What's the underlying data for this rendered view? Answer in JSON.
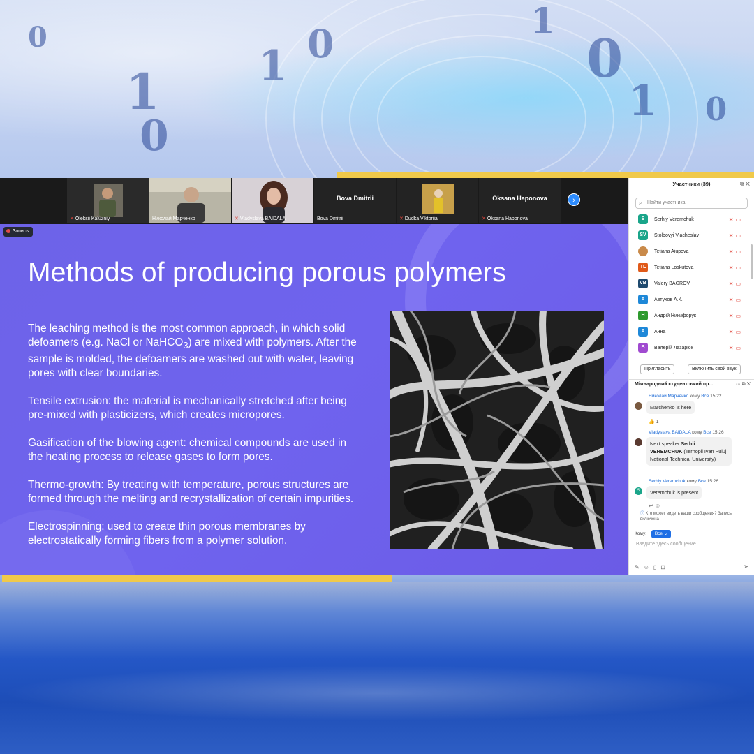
{
  "videos": {
    "tiles": [
      {
        "name": "Oleksii Kaluzniy",
        "muted": true
      },
      {
        "name": "Николай Марченко",
        "muted": false
      },
      {
        "name": "Vladyslava BAIDALA",
        "muted": true
      },
      {
        "name": "Bova Dmitrii",
        "muted": false,
        "placeholder_name": "Bova Dmitrii"
      },
      {
        "name": "Dudka Viktoriia",
        "muted": true
      },
      {
        "name": "Oksana Haponova",
        "muted": true,
        "placeholder_name": "Oksana Haponova"
      }
    ],
    "next_icon": "chevron-right-icon"
  },
  "recording": {
    "label": "Запись"
  },
  "slide": {
    "title": "Methods of producing porous polymers",
    "paragraphs": [
      {
        "pre": "The leaching method is the most common approach, in which solid defoamers (e.g. NaCl or NaHCO",
        "sub": "3",
        "post": ") are mixed with polymers. After the sample is molded, the defoamers are washed out with water, leaving pores with clear boundaries."
      },
      {
        "pre": "Tensile extrusion: the material is mechanically stretched after being pre-mixed with plasticizers, which creates micropores.",
        "sub": "",
        "post": ""
      },
      {
        "pre": "Gasification of the blowing agent: chemical compounds are used in the heating process to release gases to form pores.",
        "sub": "",
        "post": ""
      },
      {
        "pre": "Thermo-growth: By treating with temperature, porous structures are formed through the melting and recrystallization of certain impurities.",
        "sub": "",
        "post": ""
      },
      {
        "pre": "Electrospinning: used to create thin porous membranes by electrostatically forming fibers from a polymer solution.",
        "sub": "",
        "post": ""
      }
    ]
  },
  "participants": {
    "title": "Участники (39)",
    "search_placeholder": "Найти участника",
    "list": [
      {
        "initials": "S",
        "name": "Serhiy Veremchuk",
        "color": "#1aa58a"
      },
      {
        "initials": "SV",
        "name": "Stolbovyi Viacheslav",
        "color": "#1aa58a"
      },
      {
        "initials": "",
        "name": "Tetiana Aiupova",
        "color": "#c98a4a"
      },
      {
        "initials": "TL",
        "name": "Tetiana Loskutova",
        "color": "#e05a1a"
      },
      {
        "initials": "VB",
        "name": "Valery BAGROV",
        "color": "#1f4a6e"
      },
      {
        "initials": "A",
        "name": "Автухов А.К.",
        "color": "#1e88d8"
      },
      {
        "initials": "H",
        "name": "Андрій Никифорук",
        "color": "#2e9a2e"
      },
      {
        "initials": "A",
        "name": "Анна",
        "color": "#1e88d8"
      },
      {
        "initials": "B",
        "name": "Валерій Лазарюк",
        "color": "#a04ad0"
      }
    ],
    "invite_label": "Пригласить",
    "unmute_label": "Включить свой звук"
  },
  "chat": {
    "title": "Міжнародний студентський пр...",
    "messages": [
      {
        "sender": "Николай Марченко",
        "to_word": "кому",
        "to": "Все",
        "time": "15:22",
        "text": "Marchenko is here",
        "reaction": "👍 1"
      },
      {
        "sender": "Vladyslava BAIDALA",
        "to_word": "кому",
        "to": "Все",
        "time": "15:26",
        "text_pre": "Next speaker ",
        "text_bold": "Serhii VEREMCHUK",
        "text_post": " (Ternopil Ivan Puluj National Technical University)"
      },
      {
        "sender": "Serhiy Veremchuk",
        "to_word": "кому",
        "to": "Все",
        "time": "15:26",
        "text": "Veremchuk is present"
      }
    ],
    "visibility_note": "Кто может видеть ваши сообщения? Запись включена",
    "to_label": "Кому:",
    "to_value": "Все",
    "input_placeholder": "Введите здесь сообщение..."
  },
  "colors": {
    "slide_bg": "#6f63ee",
    "accent_gold": "#f0c94a",
    "zoom_blue": "#1f6fe5",
    "muted_red": "#e0463c"
  }
}
